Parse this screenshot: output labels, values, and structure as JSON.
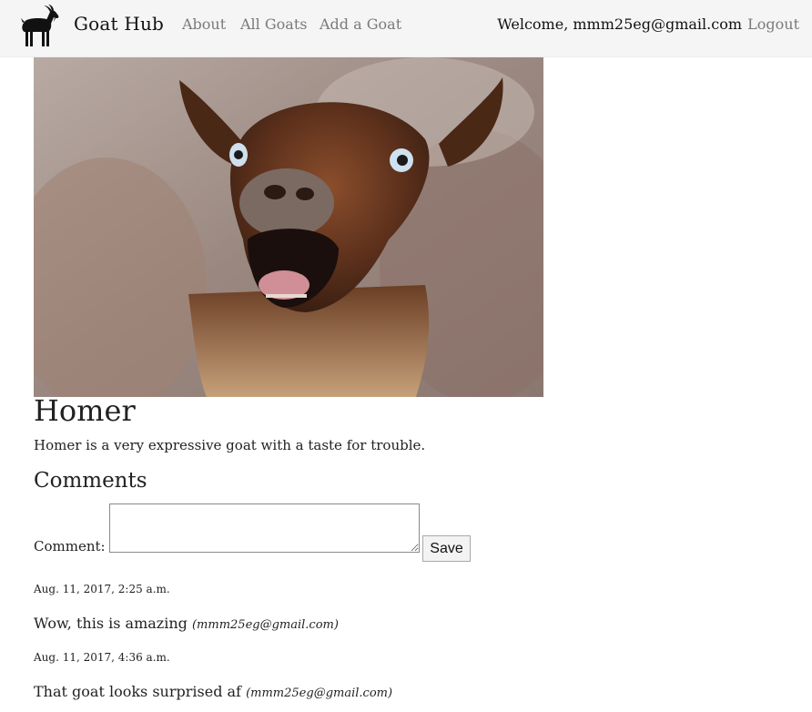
{
  "navbar": {
    "brand": "Goat Hub",
    "links": {
      "about": "About",
      "all_goats": "All Goats",
      "add_goat": "Add a Goat"
    },
    "welcome": "Welcome, mmm25eg@gmail.com",
    "logout": "Logout",
    "logo_icon": "goat-silhouette-icon"
  },
  "goat": {
    "name": "Homer",
    "description": "Homer is a very expressive goat with a taste for trouble."
  },
  "comments": {
    "heading": "Comments",
    "form": {
      "label": "Comment:",
      "input_value": "",
      "save_label": "Save"
    },
    "items": [
      {
        "date": "Aug. 11, 2017, 2:25 a.m.",
        "text": "Wow, this is amazing",
        "author": "(mmm25eg@gmail.com)"
      },
      {
        "date": "Aug. 11, 2017, 4:36 a.m.",
        "text": "That goat looks surprised af",
        "author": "(mmm25eg@gmail.com)"
      }
    ]
  },
  "colors": {
    "navbar_bg": "#f5f5f5",
    "nav_link": "#7a7a7a",
    "text": "#222222"
  }
}
